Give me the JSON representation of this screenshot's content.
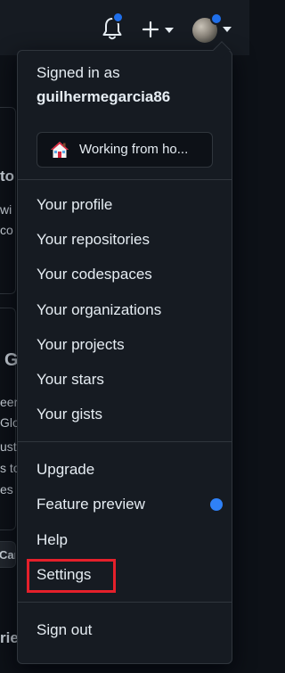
{
  "header": {
    "icons": [
      "bell-icon",
      "plus-icon",
      "chevron-down-icon"
    ],
    "notification_color": "#1f6feb"
  },
  "background": {
    "card1_title": "to",
    "card1_line1": "wi",
    "card1_line2": "co",
    "card2_title": "G",
    "card2_line1": "eer",
    "card2_line2": "Glo",
    "card2_line3": "ust",
    "card2_line4": "s to",
    "card2_line5": "es a",
    "button_label": "Car",
    "bottom_text": "rie"
  },
  "dropdown": {
    "signed_in_label": "Signed in as",
    "username": "guilhermegarcia86",
    "status": "Working from ho...",
    "items_group1": [
      "Your profile",
      "Your repositories",
      "Your codespaces",
      "Your organizations",
      "Your projects",
      "Your stars",
      "Your gists"
    ],
    "items_group2": [
      "Upgrade",
      "Feature preview",
      "Help",
      "Settings"
    ],
    "sign_out": "Sign out",
    "highlight_color": "#e5202b",
    "accent_color": "#2f81f7"
  }
}
